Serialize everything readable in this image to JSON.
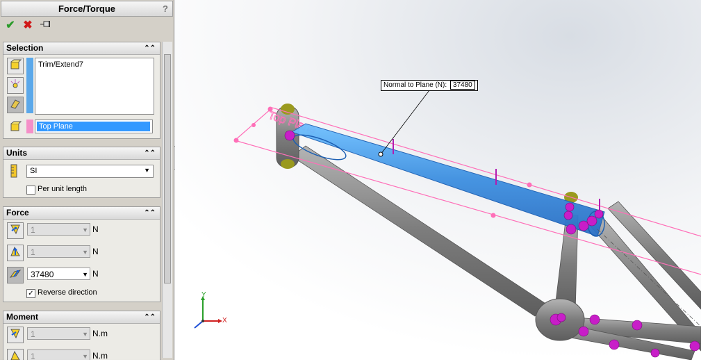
{
  "property_manager": {
    "title": "Force/Torque",
    "help_label": "?",
    "toolbar": {
      "ok_icon": "check-icon",
      "cancel_icon": "x-icon",
      "pin_icon": "pushpin-icon"
    }
  },
  "selection": {
    "header": "Selection",
    "list_items": [
      "Trim/Extend7"
    ],
    "plane_value": "Top Plane"
  },
  "units": {
    "header": "Units",
    "system": "SI",
    "per_unit_length_label": "Per unit length",
    "per_unit_length_checked": false
  },
  "force": {
    "header": "Force",
    "rows": [
      {
        "value": "1",
        "unit": "N",
        "enabled": false
      },
      {
        "value": "1",
        "unit": "N",
        "enabled": false
      },
      {
        "value": "37480",
        "unit": "N",
        "enabled": true
      }
    ],
    "reverse_direction_label": "Reverse direction",
    "reverse_direction_checked": true
  },
  "moment": {
    "header": "Moment",
    "rows": [
      {
        "value": "1",
        "unit": "N.m"
      },
      {
        "value": "1",
        "unit": "N.m"
      }
    ]
  },
  "viewport": {
    "callout_label": "Normal to Plane (N):",
    "callout_value": "37480",
    "plane_name": "Top Plane",
    "axes": {
      "x": "X",
      "y": "Y"
    },
    "colors": {
      "selection_blue": "#3d9be9",
      "plane_pink": "#ff6fb8",
      "node_magenta": "#c81ec8",
      "tube_gray": "#8a8a8a"
    }
  }
}
